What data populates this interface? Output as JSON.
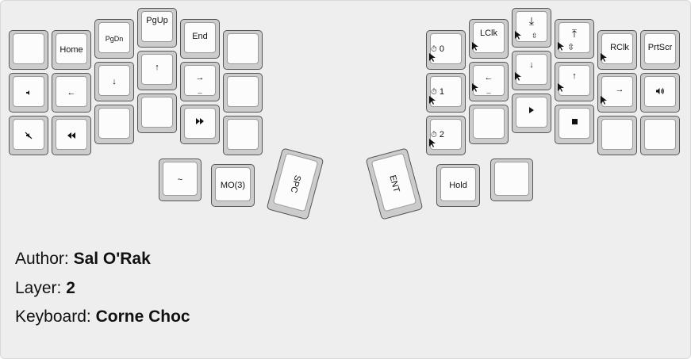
{
  "meta": {
    "author_label": "Author:",
    "author": "Sal O'Rak",
    "layer_label": "Layer:",
    "layer": "2",
    "keyboard_label": "Keyboard:",
    "keyboard": "Corne Choc"
  },
  "left": {
    "home": "Home",
    "pgdn": "PgDn",
    "pgup": "PgUp",
    "end": "End",
    "up": "↑",
    "down": "↓",
    "left_arrow": "←",
    "right_arrow": "→",
    "right_sub": "_",
    "vol_down": "🔈",
    "mute": "🔇",
    "prev": "⏪",
    "next": "⏩",
    "tilde": "~",
    "mo3": "MO(3)",
    "spc": "SPC"
  },
  "right": {
    "t0": "0",
    "t1": "1",
    "t2": "2",
    "clock": "⏱",
    "lclk": "LClk",
    "rclk": "RClk",
    "prtscr": "PrtScr",
    "scroll_down": "⤓",
    "scroll_top": "⤒",
    "updown": "⇳",
    "m_left": "←",
    "m_left_sub": "_",
    "m_down": "↓",
    "m_up": "↑",
    "m_right": "→",
    "vol_up": "🔊",
    "play": "▶",
    "stop": "■",
    "ent": "ENT",
    "hold": "Hold"
  },
  "colors": {
    "background": "#eeeeee",
    "key_border": "#555555",
    "key_side": "#cccccc",
    "key_top": "#fcfcfc"
  }
}
